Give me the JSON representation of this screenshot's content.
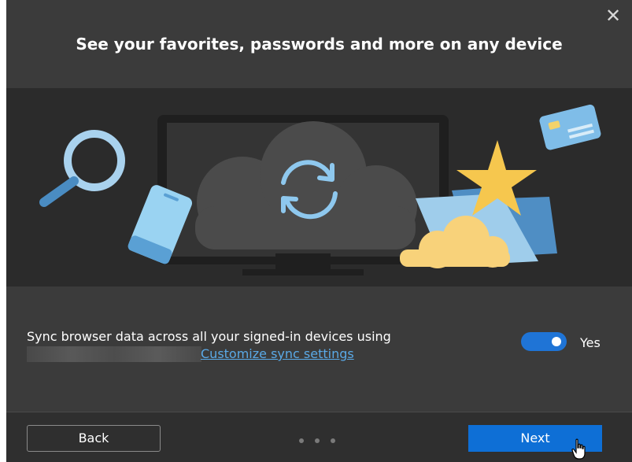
{
  "dialog": {
    "close_icon": "close-icon",
    "title": "See your favorites, passwords and more on any device"
  },
  "hero": {
    "icons": [
      "magnifier-icon",
      "phone-icon",
      "monitor-icon",
      "cloud-sync-icon",
      "credit-card-icon",
      "star-icon",
      "folder-icon",
      "small-cloud-icon"
    ]
  },
  "sync": {
    "description": "Sync browser data across all your signed-in devices using",
    "customize_link": "Customize sync settings",
    "toggle_state": "on",
    "toggle_label": "Yes"
  },
  "footer": {
    "back_label": "Back",
    "next_label": "Next",
    "page_dots": {
      "count": 3,
      "active_index": 2
    }
  },
  "colors": {
    "dialog_bg": "#3b3b3b",
    "hero_bg": "#2b2b2b",
    "accent": "#0e6fd6",
    "link": "#5aa9e6"
  }
}
